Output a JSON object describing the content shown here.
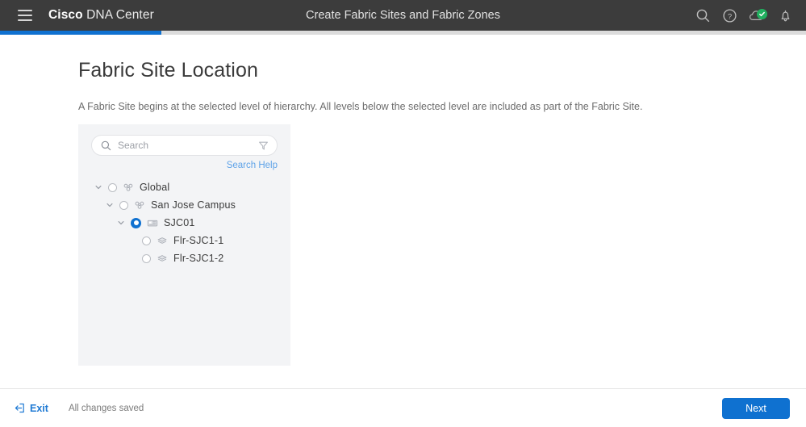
{
  "header": {
    "menu_icon": "hamburger-icon",
    "brand_bold": "Cisco",
    "brand_rest": " DNA Center",
    "title": "Create Fabric Sites and Fabric Zones",
    "icons": [
      {
        "name": "search-icon",
        "label": "Search"
      },
      {
        "name": "help-icon",
        "label": "Help"
      },
      {
        "name": "cloud-status-icon",
        "label": "Cloud connected"
      },
      {
        "name": "notifications-bell-icon",
        "label": "Notifications"
      }
    ],
    "cloud_badge_color": "#21b05f",
    "background_color": "#3c3c3c"
  },
  "progress": {
    "percent": 20,
    "fill_color": "#0f71d0",
    "track_color": "#dcdcdc"
  },
  "page": {
    "title": "Fabric Site Location",
    "description": "A Fabric Site begins at the selected level of hierarchy. All levels below the selected level are included as part of the Fabric Site."
  },
  "search": {
    "placeholder": "Search",
    "value": "",
    "help_label": "Search Help",
    "help_color": "#5fa3e8",
    "search_icon": "magnifier-icon",
    "filter_icon": "funnel-filter-icon"
  },
  "tree": {
    "panel_background": "#f3f4f6",
    "nodes": [
      {
        "label": "Global",
        "indent": 0,
        "expanded": true,
        "selected": false,
        "icon": "site-group-icon",
        "has_chevron": true
      },
      {
        "label": "San Jose Campus",
        "indent": 1,
        "expanded": true,
        "selected": false,
        "icon": "site-group-icon",
        "has_chevron": true
      },
      {
        "label": "SJC01",
        "indent": 2,
        "expanded": true,
        "selected": true,
        "icon": "building-icon",
        "has_chevron": true
      },
      {
        "label": "Flr-SJC1-1",
        "indent": 3,
        "expanded": false,
        "selected": false,
        "icon": "floor-icon",
        "has_chevron": false
      },
      {
        "label": "Flr-SJC1-2",
        "indent": 3,
        "expanded": false,
        "selected": false,
        "icon": "floor-icon",
        "has_chevron": false
      }
    ],
    "selected_color": "#0f71d0"
  },
  "footer": {
    "exit_label": "Exit",
    "exit_icon": "exit-arrow-icon",
    "exit_color": "#1f7ad4",
    "status_text": "All changes saved",
    "next_label": "Next",
    "next_color": "#0f71d0"
  }
}
